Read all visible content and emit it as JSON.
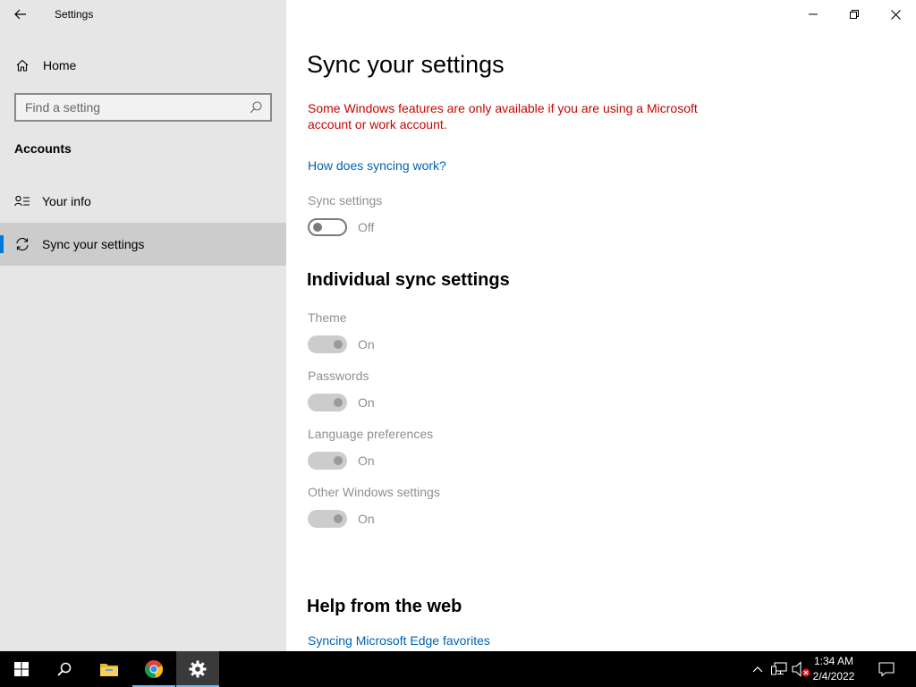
{
  "window": {
    "title": "Settings"
  },
  "sidebar": {
    "home_label": "Home",
    "search": {
      "placeholder": "Find a setting"
    },
    "section_label": "Accounts",
    "items": [
      {
        "label": "Your info",
        "icon": "person-list-icon",
        "active": false
      },
      {
        "label": "Sync your settings",
        "icon": "sync-icon",
        "active": true
      }
    ]
  },
  "main": {
    "title": "Sync your settings",
    "warning": "Some Windows features are only available if you are using a Microsoft account or work account.",
    "how_link": "How does syncing work?",
    "sync_settings": {
      "label": "Sync settings",
      "state": "Off"
    },
    "individual_heading": "Individual sync settings",
    "individual": [
      {
        "label": "Theme",
        "state": "On"
      },
      {
        "label": "Passwords",
        "state": "On"
      },
      {
        "label": "Language preferences",
        "state": "On"
      },
      {
        "label": "Other Windows settings",
        "state": "On"
      }
    ],
    "help_heading": "Help from the web",
    "help_link": "Syncing Microsoft Edge favorites"
  },
  "taskbar": {
    "apps": [
      "start-icon",
      "search-icon",
      "file-explorer-icon",
      "chrome-icon",
      "settings-icon"
    ],
    "clock": {
      "time": "1:34 AM",
      "date": "2/4/2022"
    }
  },
  "colors": {
    "accent": "#0078d7",
    "warning": "#c50500",
    "link": "#0063b1",
    "sidebar_bg": "#e6e6e6",
    "taskbar_bg": "#000000"
  }
}
